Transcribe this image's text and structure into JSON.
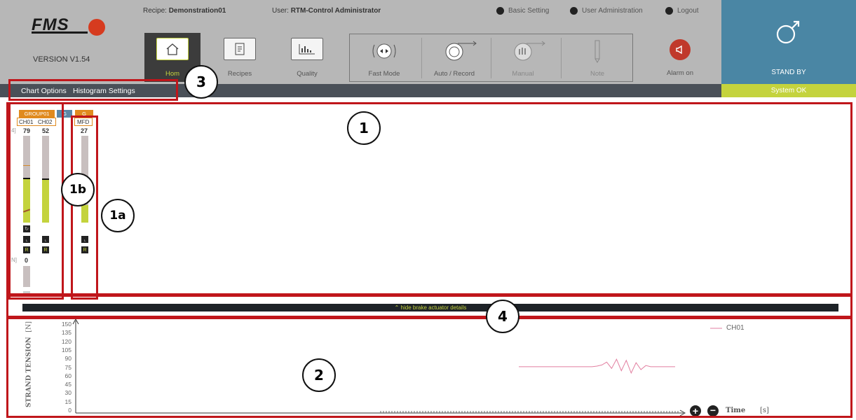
{
  "brand": {
    "logo": "FMS",
    "version": "VERSION V1.54"
  },
  "header": {
    "recipe_label": "Recipe:",
    "recipe_value": "Demonstration01",
    "user_label": "User:",
    "user_value": "RTM-Control Administrator",
    "basic_setting": "Basic Setting",
    "user_admin": "User Administration",
    "logout": "Logout"
  },
  "toolbar": {
    "home": "Hom",
    "recipes": "Recipes",
    "quality": "Quality",
    "fast_mode": "Fast Mode",
    "auto_record": "Auto / Record",
    "manual": "Manual",
    "note": "Note",
    "alarm": "Alarm on"
  },
  "status": {
    "standby": "STAND BY",
    "system_ok": "System OK"
  },
  "menu": {
    "chart_options": "Chart Options",
    "histogram_settings": "Histogram Settings"
  },
  "groups": {
    "group01": "GROUP01",
    "g2": "G",
    "g3": "G",
    "ch01": "CH01",
    "ch02": "CH02",
    "mfd": "MFD",
    "ch01_val": "79",
    "ch02_val": "52",
    "mfd_val": "27",
    "n_unit_a": "4]",
    "n_unit_b": "N]",
    "lower_val": "0"
  },
  "callouts": {
    "c1": "1",
    "c1a": "1a",
    "c1b": "1b",
    "c2": "2",
    "c3": "3",
    "c4": "4"
  },
  "details_bar": {
    "label": "hide brake actuator details"
  },
  "chart_data": {
    "type": "line",
    "ylabel": "STRAND TENSION",
    "yunit": "[N]",
    "xlabel": "Time",
    "xunit": "[s]",
    "ylim": [
      0,
      150
    ],
    "yticks": [
      "150",
      "135",
      "120",
      "105",
      "90",
      "75",
      "60",
      "45",
      "30",
      "15",
      "0"
    ],
    "legend": "top-right",
    "series": [
      {
        "name": "CH01",
        "color": "#e27fa0",
        "values": [
          77,
          77,
          77,
          77,
          77,
          77,
          77,
          77,
          77,
          77,
          77,
          77,
          77,
          77,
          77,
          77,
          78,
          80,
          85,
          74,
          90,
          70,
          88,
          66,
          84,
          72,
          79,
          77,
          77,
          77,
          77,
          77,
          77
        ]
      }
    ]
  }
}
